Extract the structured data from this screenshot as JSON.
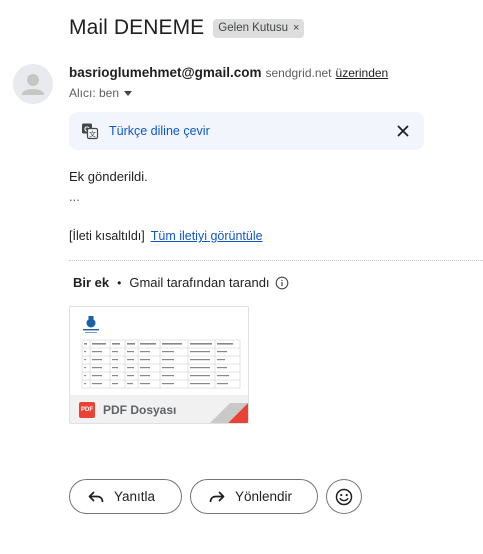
{
  "message": {
    "subject": "Mail DENEME",
    "label_chip": "Gelen Kutusu",
    "label_chip_close": "×"
  },
  "sender": {
    "email": "basrioglumehmet@gmail.com",
    "via_domain": "sendgrid.net",
    "via_link": "üzerinden",
    "to_text": "Alıcı: ben"
  },
  "translate": {
    "label": "Türkçe diline çevir",
    "icon": "translate-icon",
    "close_icon": "close-icon",
    "background": "#f2f6fc",
    "link_color": "#0b57d0"
  },
  "body": {
    "text": "Ek gönderildi.",
    "ellipsis": "...",
    "clipped_notice": "[İleti kısaltıldı]",
    "view_full_link": "Tüm iletiyi görüntüle"
  },
  "attachments": {
    "count_label": "Bir ek",
    "separator": "•",
    "scan_text": "Gmail tarafından tarandı",
    "items": [
      {
        "name": "PDF Dosyası",
        "type_badge": "PDF",
        "icon": "pdf-icon",
        "badge_color": "#ea4335",
        "corner_color": "#ea4335"
      }
    ]
  },
  "actions": {
    "reply_label": "Yanıtla",
    "forward_label": "Yönlendir",
    "reply_icon": "reply-icon",
    "forward_icon": "forward-icon",
    "emoji_icon": "emoji-icon"
  }
}
